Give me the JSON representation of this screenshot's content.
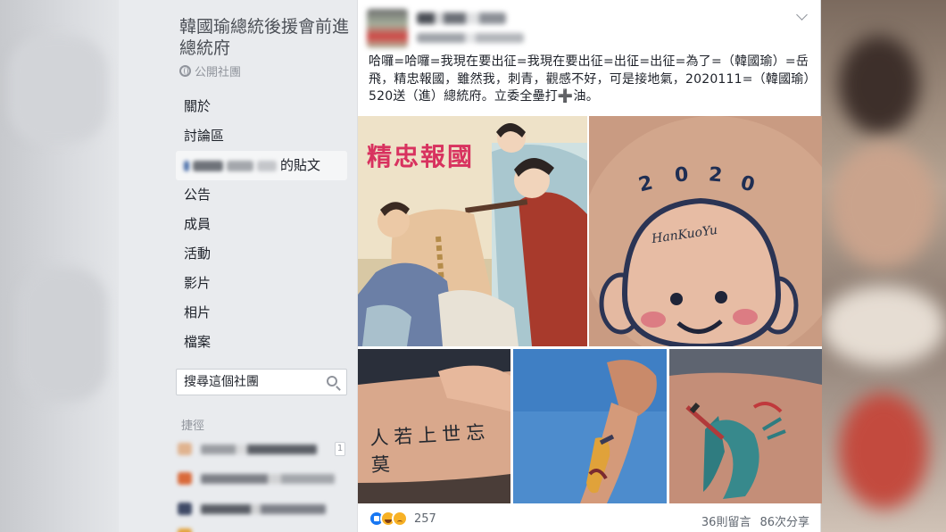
{
  "sidebar": {
    "group_title": "韓國瑜總統後援會前進總統府",
    "group_type": "公開社團",
    "nav": [
      {
        "label": "關於"
      },
      {
        "label": "討論區"
      },
      {
        "label": "的貼文"
      },
      {
        "label": "公告"
      },
      {
        "label": "成員"
      },
      {
        "label": "活動"
      },
      {
        "label": "影片"
      },
      {
        "label": "相片"
      },
      {
        "label": "檔案"
      }
    ],
    "search_placeholder": "搜尋這個社團",
    "shortcuts_title": "捷徑",
    "shortcuts": [
      {
        "count": "1"
      },
      {
        "count": ""
      },
      {
        "count": ""
      }
    ]
  },
  "post": {
    "text": "哈囉=哈囉=我現在要出征=我現在要出征=出征=出征=為了=（韓國瑜）=岳飛，精忠報國，雖然我，刺青，觀感不好，可是接地氣，2020111=（韓國瑜）520送（進）總統府。立委全壘打➕油。",
    "images": {
      "painting_caption": "精忠報國",
      "tattoo_year": "2020",
      "tattoo_signature": "HanKuoYu",
      "arm_tattoo_text": "人若上世忘莫"
    },
    "reaction_count": "257",
    "comments": "36則留言",
    "shares": "86次分享"
  },
  "colors": {
    "facebook_blue": "#1877f2",
    "sidebar_bg": "#e9ebee",
    "caption_red": "#d8325f"
  }
}
